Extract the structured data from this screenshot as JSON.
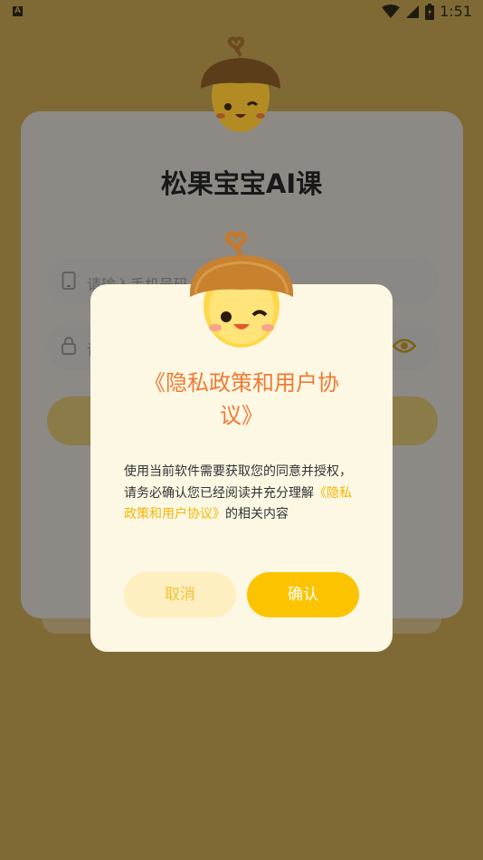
{
  "status_bar": {
    "time": "1:51",
    "left_icon_glyph": "A"
  },
  "login": {
    "title": "松果宝宝AI课",
    "phone_placeholder": "请输入手机号码",
    "password_placeholder": "请"
  },
  "dialog": {
    "title_line1": "《隐私政策和用户协",
    "title_line2": "议》",
    "body_text": "使用当前软件需要获取您的同意并授权，请务必确认您已经阅读并充分理解",
    "body_link": "《隐私政策和用户协议》",
    "body_suffix": "的相关内容",
    "cancel_label": "取消",
    "confirm_label": "确认"
  },
  "colors": {
    "overlay": "#7f6a36",
    "title_orange": "#f07a33",
    "link_yellow": "#f3b400",
    "confirm_button": "#fcc400",
    "cancel_button": "#fdefbf"
  }
}
